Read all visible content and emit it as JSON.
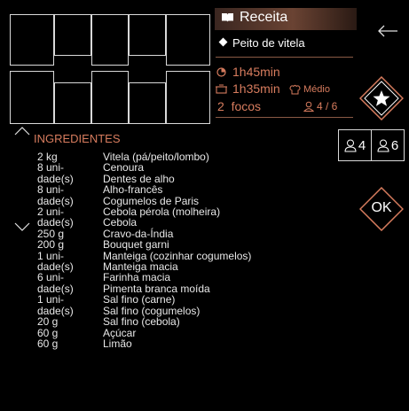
{
  "header": {
    "title": "Receita",
    "dish": "Peito de vitela",
    "back_icon": "arrow-left-icon"
  },
  "times": {
    "total": "1h45min",
    "cook": "1h35min",
    "difficulty": "Médio",
    "focos": "2  focos",
    "servings": "4 / 6"
  },
  "favorite_icon": "star-icon",
  "ok_label": "OK",
  "portions": [
    {
      "label": "4",
      "icon": "person-icon"
    },
    {
      "label": "6",
      "icon": "person-icon"
    }
  ],
  "ingredients": {
    "title": "INGREDIENTES",
    "quantities": [
      "2 kg",
      "8 uni-",
      "dade(s)",
      "8 uni-",
      "dade(s)",
      "2 uni-",
      "dade(s)",
      "250 g",
      "200 g",
      "1 uni-",
      "dade(s)",
      "6 uni-",
      "dade(s)",
      "1 uni-",
      "dade(s)",
      "20 g",
      "60 g",
      "60 g"
    ],
    "names": [
      "Vitela (pá/peito/lombo)",
      "Cenoura",
      "Dentes de alho",
      "Alho-francês",
      "Cogumelos de Paris",
      "Cebola pérola (molheira)",
      "Cebola",
      "Cravo-da-Índia",
      "Bouquet garni",
      "Manteiga (cozinhar cogumelos)",
      "Manteiga macia",
      "Farinha macia",
      "Pimenta branca moída",
      "Sal fino (carne)",
      "Sal fino (cogumelos)",
      "Sal fino (cebola)",
      "Açúcar",
      "Limão"
    ]
  },
  "colors": {
    "accent": "#d77c5e",
    "line": "#d9d9d9"
  }
}
